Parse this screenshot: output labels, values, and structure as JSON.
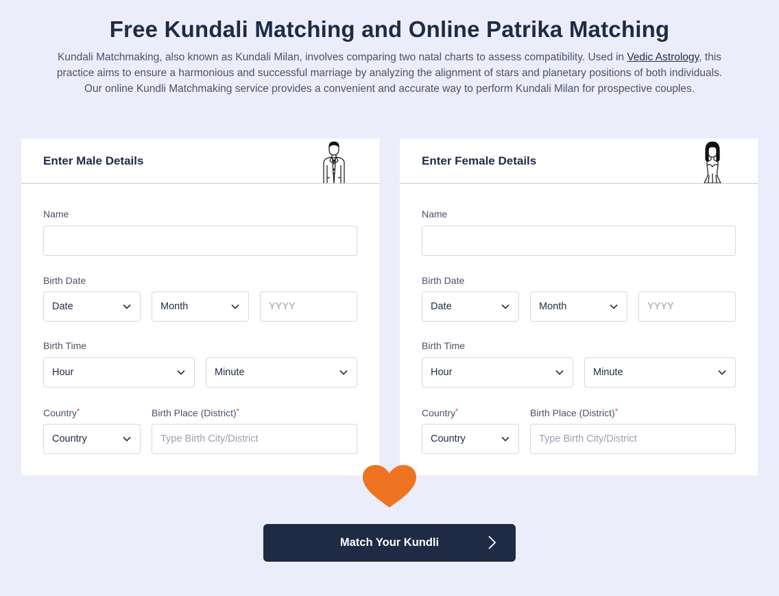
{
  "page": {
    "title": "Free Kundali Matching and Online Patrika Matching",
    "intro_before_link": "Kundali Matchmaking, also known as Kundali Milan, involves comparing two natal charts to assess compatibility. Used in ",
    "intro_link": "Vedic Astrology",
    "intro_after_link": ", this practice aims to ensure a harmonious and successful marriage by analyzing the alignment of stars and planetary positions of both individuals. Our online Kundli Matchmaking service provides a convenient and accurate way to perform Kundali Milan for prospective couples."
  },
  "male": {
    "title": "Enter Male Details",
    "avatar_icon": "groom-icon",
    "name_label": "Name",
    "name_value": "",
    "birth_date_label": "Birth Date",
    "date_select": "Date",
    "month_select": "Month",
    "year_placeholder": "YYYY",
    "birth_time_label": "Birth Time",
    "hour_select": "Hour",
    "minute_select": "Minute",
    "country_label": "Country",
    "country_select": "Country",
    "place_label": "Birth Place (District)",
    "place_placeholder": "Type Birth City/District",
    "required_mark": "*"
  },
  "female": {
    "title": "Enter Female Details",
    "avatar_icon": "bride-icon",
    "name_label": "Name",
    "name_value": "",
    "birth_date_label": "Birth Date",
    "date_select": "Date",
    "month_select": "Month",
    "year_placeholder": "YYYY",
    "birth_time_label": "Birth Time",
    "hour_select": "Hour",
    "minute_select": "Minute",
    "country_label": "Country",
    "country_select": "Country",
    "place_label": "Birth Place (District)",
    "place_placeholder": "Type Birth City/District",
    "required_mark": "*"
  },
  "decor": {
    "heart_icon": "heart-icon",
    "heart_color": "#ee7421"
  },
  "cta": {
    "label": "Match Your Kundli",
    "icon": "chevron-right-icon",
    "bg_color": "#1f2a44"
  },
  "colors": {
    "page_bg": "#ebeefa",
    "text": "#1f2a44",
    "required": "#e53935"
  }
}
